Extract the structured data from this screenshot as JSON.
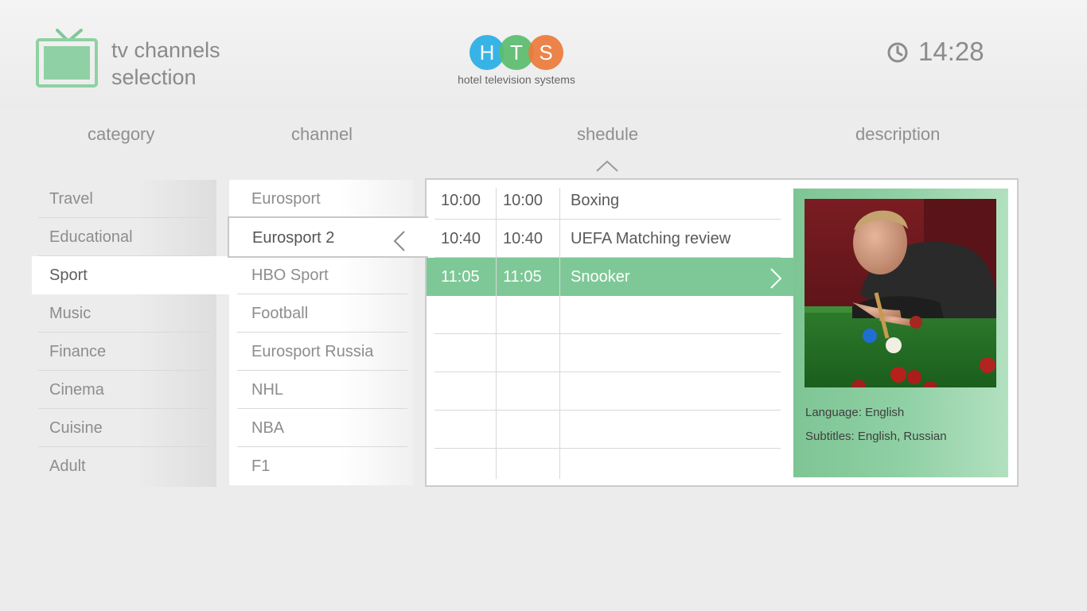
{
  "header": {
    "title_line1": "tv channels",
    "title_line2": "selection",
    "logo_letters": [
      "H",
      "T",
      "S"
    ],
    "logo_colors": [
      "#29aee6",
      "#5cbd6e",
      "#ec7a3c"
    ],
    "logo_subtitle": "hotel television systems",
    "time": "14:28"
  },
  "columns": {
    "category": "category",
    "channel": "channel",
    "schedule": "shedule",
    "description": "description"
  },
  "categories": [
    {
      "label": "Travel"
    },
    {
      "label": "Educational"
    },
    {
      "label": "Sport",
      "selected": true
    },
    {
      "label": "Music"
    },
    {
      "label": "Finance"
    },
    {
      "label": "Cinema"
    },
    {
      "label": "Cuisine"
    },
    {
      "label": "Adult"
    }
  ],
  "channels": [
    {
      "label": "Eurosport"
    },
    {
      "label": "Eurosport 2",
      "focused": true
    },
    {
      "label": "HBO Sport"
    },
    {
      "label": "Football"
    },
    {
      "label": "Eurosport Russia"
    },
    {
      "label": "NHL"
    },
    {
      "label": "NBA"
    },
    {
      "label": "F1"
    }
  ],
  "schedule": [
    {
      "start": "10:00",
      "end": "10:00",
      "title": "Boxing"
    },
    {
      "start": "10:40",
      "end": "10:40",
      "title": "UEFA Matching review"
    },
    {
      "start": "11:05",
      "end": "11:05",
      "title": "Snooker",
      "selected": true
    }
  ],
  "description": {
    "language": "Language: English",
    "subtitles": "Subtitles: English, Russian"
  },
  "colors": {
    "accent_green": "#7ec897",
    "text_gray": "#8d8d8d"
  },
  "icons": {
    "tv": "tv-icon",
    "clock": "clock-icon",
    "caret_up": "chevron-up-icon",
    "arrow_left": "chevron-left-icon",
    "arrow_right": "chevron-right-icon"
  }
}
